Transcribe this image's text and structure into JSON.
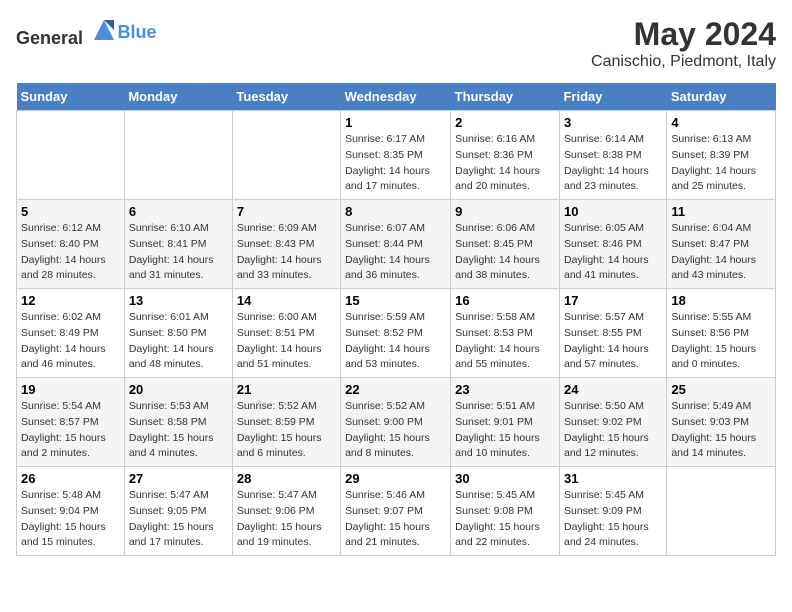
{
  "logo": {
    "general": "General",
    "blue": "Blue"
  },
  "header": {
    "month": "May 2024",
    "location": "Canischio, Piedmont, Italy"
  },
  "weekdays": [
    "Sunday",
    "Monday",
    "Tuesday",
    "Wednesday",
    "Thursday",
    "Friday",
    "Saturday"
  ],
  "weeks": [
    [
      {
        "day": "",
        "info": ""
      },
      {
        "day": "",
        "info": ""
      },
      {
        "day": "",
        "info": ""
      },
      {
        "day": "1",
        "info": "Sunrise: 6:17 AM\nSunset: 8:35 PM\nDaylight: 14 hours\nand 17 minutes."
      },
      {
        "day": "2",
        "info": "Sunrise: 6:16 AM\nSunset: 8:36 PM\nDaylight: 14 hours\nand 20 minutes."
      },
      {
        "day": "3",
        "info": "Sunrise: 6:14 AM\nSunset: 8:38 PM\nDaylight: 14 hours\nand 23 minutes."
      },
      {
        "day": "4",
        "info": "Sunrise: 6:13 AM\nSunset: 8:39 PM\nDaylight: 14 hours\nand 25 minutes."
      }
    ],
    [
      {
        "day": "5",
        "info": "Sunrise: 6:12 AM\nSunset: 8:40 PM\nDaylight: 14 hours\nand 28 minutes."
      },
      {
        "day": "6",
        "info": "Sunrise: 6:10 AM\nSunset: 8:41 PM\nDaylight: 14 hours\nand 31 minutes."
      },
      {
        "day": "7",
        "info": "Sunrise: 6:09 AM\nSunset: 8:43 PM\nDaylight: 14 hours\nand 33 minutes."
      },
      {
        "day": "8",
        "info": "Sunrise: 6:07 AM\nSunset: 8:44 PM\nDaylight: 14 hours\nand 36 minutes."
      },
      {
        "day": "9",
        "info": "Sunrise: 6:06 AM\nSunset: 8:45 PM\nDaylight: 14 hours\nand 38 minutes."
      },
      {
        "day": "10",
        "info": "Sunrise: 6:05 AM\nSunset: 8:46 PM\nDaylight: 14 hours\nand 41 minutes."
      },
      {
        "day": "11",
        "info": "Sunrise: 6:04 AM\nSunset: 8:47 PM\nDaylight: 14 hours\nand 43 minutes."
      }
    ],
    [
      {
        "day": "12",
        "info": "Sunrise: 6:02 AM\nSunset: 8:49 PM\nDaylight: 14 hours\nand 46 minutes."
      },
      {
        "day": "13",
        "info": "Sunrise: 6:01 AM\nSunset: 8:50 PM\nDaylight: 14 hours\nand 48 minutes."
      },
      {
        "day": "14",
        "info": "Sunrise: 6:00 AM\nSunset: 8:51 PM\nDaylight: 14 hours\nand 51 minutes."
      },
      {
        "day": "15",
        "info": "Sunrise: 5:59 AM\nSunset: 8:52 PM\nDaylight: 14 hours\nand 53 minutes."
      },
      {
        "day": "16",
        "info": "Sunrise: 5:58 AM\nSunset: 8:53 PM\nDaylight: 14 hours\nand 55 minutes."
      },
      {
        "day": "17",
        "info": "Sunrise: 5:57 AM\nSunset: 8:55 PM\nDaylight: 14 hours\nand 57 minutes."
      },
      {
        "day": "18",
        "info": "Sunrise: 5:55 AM\nSunset: 8:56 PM\nDaylight: 15 hours\nand 0 minutes."
      }
    ],
    [
      {
        "day": "19",
        "info": "Sunrise: 5:54 AM\nSunset: 8:57 PM\nDaylight: 15 hours\nand 2 minutes."
      },
      {
        "day": "20",
        "info": "Sunrise: 5:53 AM\nSunset: 8:58 PM\nDaylight: 15 hours\nand 4 minutes."
      },
      {
        "day": "21",
        "info": "Sunrise: 5:52 AM\nSunset: 8:59 PM\nDaylight: 15 hours\nand 6 minutes."
      },
      {
        "day": "22",
        "info": "Sunrise: 5:52 AM\nSunset: 9:00 PM\nDaylight: 15 hours\nand 8 minutes."
      },
      {
        "day": "23",
        "info": "Sunrise: 5:51 AM\nSunset: 9:01 PM\nDaylight: 15 hours\nand 10 minutes."
      },
      {
        "day": "24",
        "info": "Sunrise: 5:50 AM\nSunset: 9:02 PM\nDaylight: 15 hours\nand 12 minutes."
      },
      {
        "day": "25",
        "info": "Sunrise: 5:49 AM\nSunset: 9:03 PM\nDaylight: 15 hours\nand 14 minutes."
      }
    ],
    [
      {
        "day": "26",
        "info": "Sunrise: 5:48 AM\nSunset: 9:04 PM\nDaylight: 15 hours\nand 15 minutes."
      },
      {
        "day": "27",
        "info": "Sunrise: 5:47 AM\nSunset: 9:05 PM\nDaylight: 15 hours\nand 17 minutes."
      },
      {
        "day": "28",
        "info": "Sunrise: 5:47 AM\nSunset: 9:06 PM\nDaylight: 15 hours\nand 19 minutes."
      },
      {
        "day": "29",
        "info": "Sunrise: 5:46 AM\nSunset: 9:07 PM\nDaylight: 15 hours\nand 21 minutes."
      },
      {
        "day": "30",
        "info": "Sunrise: 5:45 AM\nSunset: 9:08 PM\nDaylight: 15 hours\nand 22 minutes."
      },
      {
        "day": "31",
        "info": "Sunrise: 5:45 AM\nSunset: 9:09 PM\nDaylight: 15 hours\nand 24 minutes."
      },
      {
        "day": "",
        "info": ""
      }
    ]
  ]
}
